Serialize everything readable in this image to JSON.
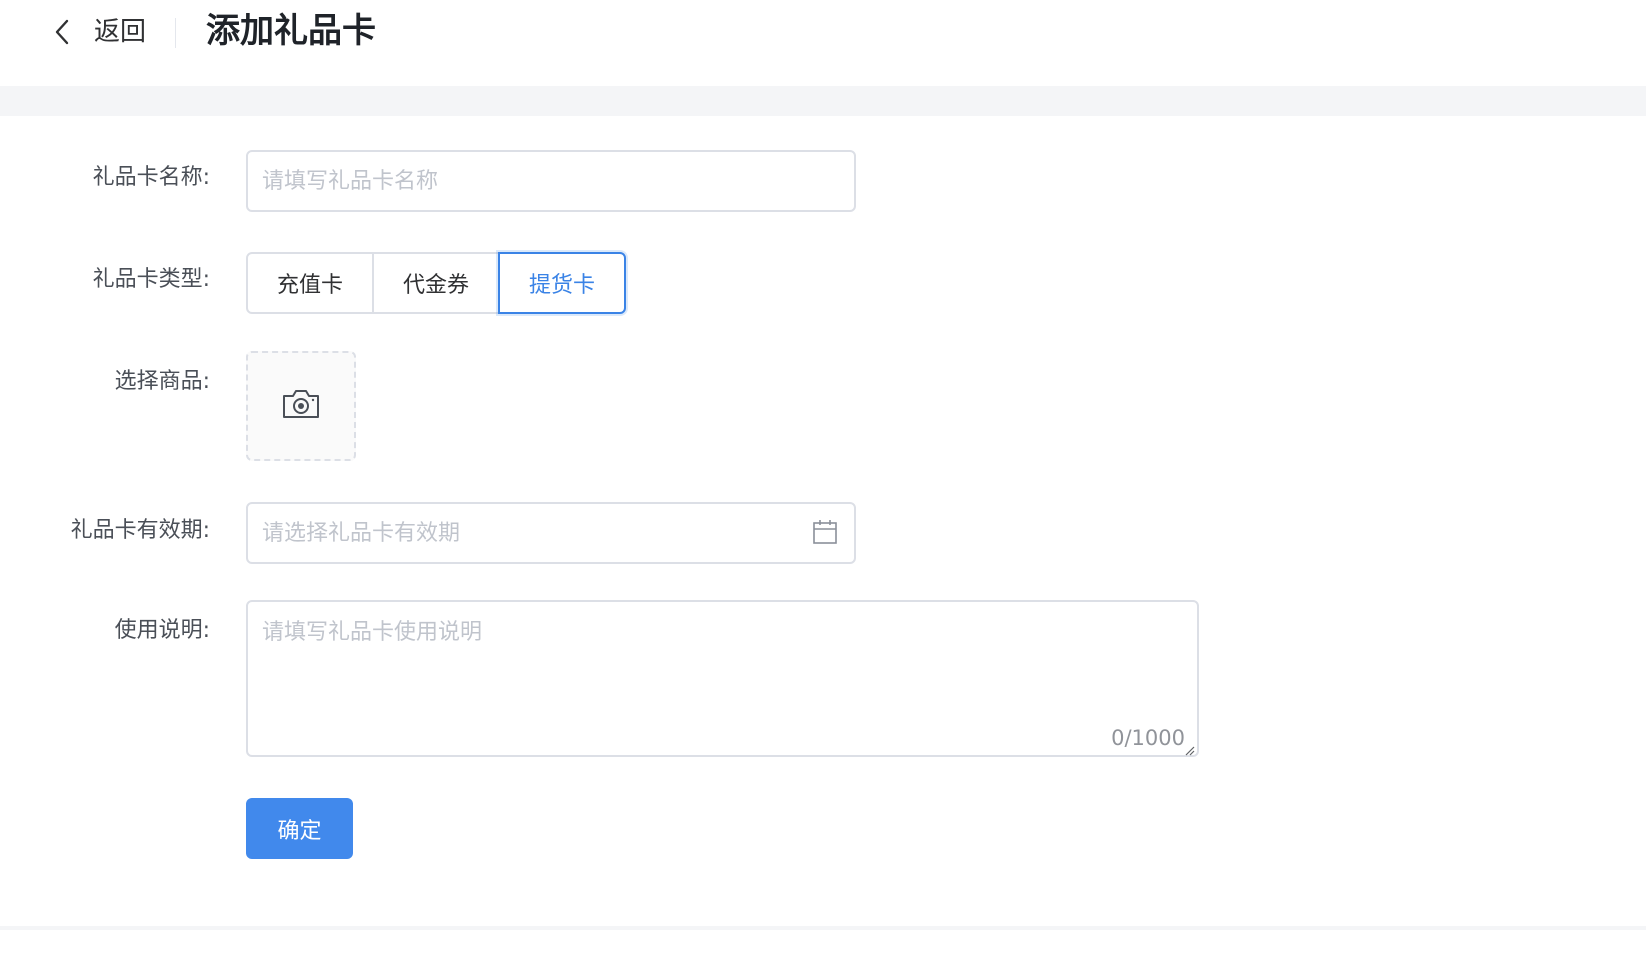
{
  "header": {
    "back_label": "返回",
    "title": "添加礼品卡"
  },
  "form": {
    "name": {
      "label": "礼品卡名称:",
      "placeholder": "请填写礼品卡名称",
      "value": ""
    },
    "type": {
      "label": "礼品卡类型:",
      "options": [
        "充值卡",
        "代金券",
        "提货卡"
      ],
      "selected": "提货卡"
    },
    "product": {
      "label": "选择商品:",
      "icon": "camera-icon"
    },
    "validity": {
      "label": "礼品卡有效期:",
      "placeholder": "请选择礼品卡有效期",
      "icon": "calendar-icon"
    },
    "description": {
      "label": "使用说明:",
      "placeholder": "请填写礼品卡使用说明",
      "count": "0/1000"
    },
    "submit_label": "确定"
  },
  "colors": {
    "accent": "#3a83e6",
    "primary_button": "#4189ec",
    "border": "#dcdfe6",
    "placeholder": "#c0c4cc"
  }
}
